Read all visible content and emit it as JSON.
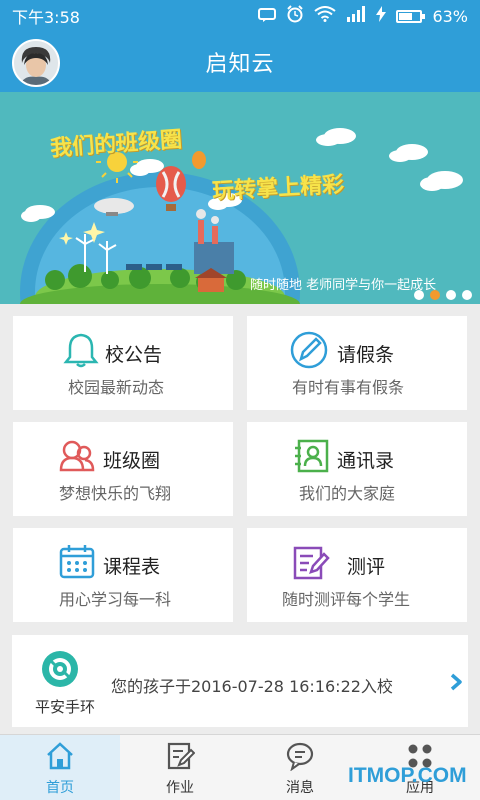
{
  "status_bar": {
    "time": "下午3:58",
    "battery_text": "63%",
    "battery_level": 0.63,
    "icons": [
      "message-icon",
      "alarm-icon",
      "wifi-icon",
      "signal-icon",
      "charging-icon",
      "battery-icon"
    ]
  },
  "header": {
    "title": "启知云"
  },
  "banner": {
    "slogan_line1": "我们的班级圈",
    "slogan_line2": "玩转掌上精彩",
    "subtitle": "随时随地 老师同学与你一起成长",
    "active_dot": 1,
    "dot_count": 4
  },
  "cards": [
    {
      "title": "校公告",
      "subtitle": "校园最新动态",
      "icon": "bell-icon",
      "color": "#2bb6b1"
    },
    {
      "title": "请假条",
      "subtitle": "有时有事有假条",
      "icon": "pen-icon",
      "color": "#2f9ed8"
    },
    {
      "title": "班级圈",
      "subtitle": "梦想快乐的飞翔",
      "icon": "group-icon",
      "color": "#e05a5a"
    },
    {
      "title": "通讯录",
      "subtitle": "我们的大家庭",
      "icon": "contacts-icon",
      "color": "#4bb04b"
    },
    {
      "title": "课程表",
      "subtitle": "用心学习每一科",
      "icon": "calendar-icon",
      "color": "#2f9ed8"
    },
    {
      "title": "测评",
      "subtitle": "随时测评每个学生",
      "icon": "test-edit-icon",
      "color": "#8a4bb8"
    }
  ],
  "notify": {
    "label": "平安手环",
    "message": "您的孩子于2016-07-28 16:16:22入校"
  },
  "tabs": [
    {
      "label": "首页",
      "icon": "home-icon",
      "active": true
    },
    {
      "label": "作业",
      "icon": "homework-icon",
      "active": false
    },
    {
      "label": "消息",
      "icon": "message-bubble-icon",
      "active": false
    },
    {
      "label": "应用",
      "icon": "apps-icon",
      "active": false
    }
  ],
  "watermark": "ITMOP.COM",
  "colors": {
    "primary": "#2f9ed8",
    "banner_bg": "#50b9be",
    "active_dot": "#f29a2e"
  }
}
